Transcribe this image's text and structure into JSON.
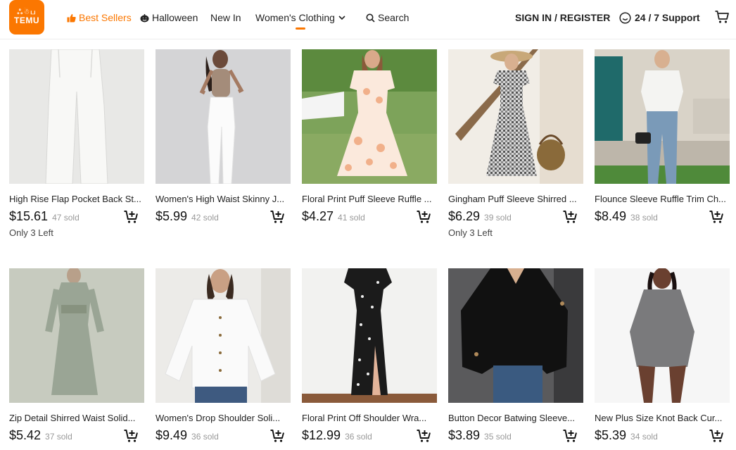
{
  "header": {
    "logo_text": "TEMU",
    "logo_glyphs": "ஃ☃ப",
    "nav": [
      {
        "label": "Best Sellers",
        "icon": "thumbs-up-icon"
      },
      {
        "label": "Halloween",
        "icon": "pumpkin-icon"
      },
      {
        "label": "New In"
      },
      {
        "label": "Women's Clothing",
        "icon": "chevron-down-icon"
      },
      {
        "label": "Search",
        "icon": "search-icon"
      }
    ],
    "sign_in": "SIGN IN / REGISTER",
    "support": "24 / 7 Support",
    "accent_color": "#fb7701"
  },
  "products": [
    {
      "title": "High Rise Flap Pocket Back St...",
      "price": "$15.61",
      "sold": "47 sold",
      "stock_note": "Only 3 Left"
    },
    {
      "title": "Women's High Waist Skinny J...",
      "price": "$5.99",
      "sold": "42 sold",
      "stock_note": ""
    },
    {
      "title": "Floral Print Puff Sleeve Ruffle ...",
      "price": "$4.27",
      "sold": "41 sold",
      "stock_note": ""
    },
    {
      "title": "Gingham Puff Sleeve Shirred ...",
      "price": "$6.29",
      "sold": "39 sold",
      "stock_note": "Only 3 Left"
    },
    {
      "title": "Flounce Sleeve Ruffle Trim Ch...",
      "price": "$8.49",
      "sold": "38 sold",
      "stock_note": ""
    },
    {
      "title": "Zip Detail Shirred Waist Solid...",
      "price": "$5.42",
      "sold": "37 sold",
      "stock_note": ""
    },
    {
      "title": "Women's Drop Shoulder Soli...",
      "price": "$9.49",
      "sold": "36 sold",
      "stock_note": ""
    },
    {
      "title": "Floral Print Off Shoulder Wra...",
      "price": "$12.99",
      "sold": "36 sold",
      "stock_note": ""
    },
    {
      "title": "Button Decor Batwing Sleeve...",
      "price": "$3.89",
      "sold": "35 sold",
      "stock_note": ""
    },
    {
      "title": "New Plus Size Knot Back Cur...",
      "price": "$5.39",
      "sold": "34 sold",
      "stock_note": ""
    }
  ]
}
